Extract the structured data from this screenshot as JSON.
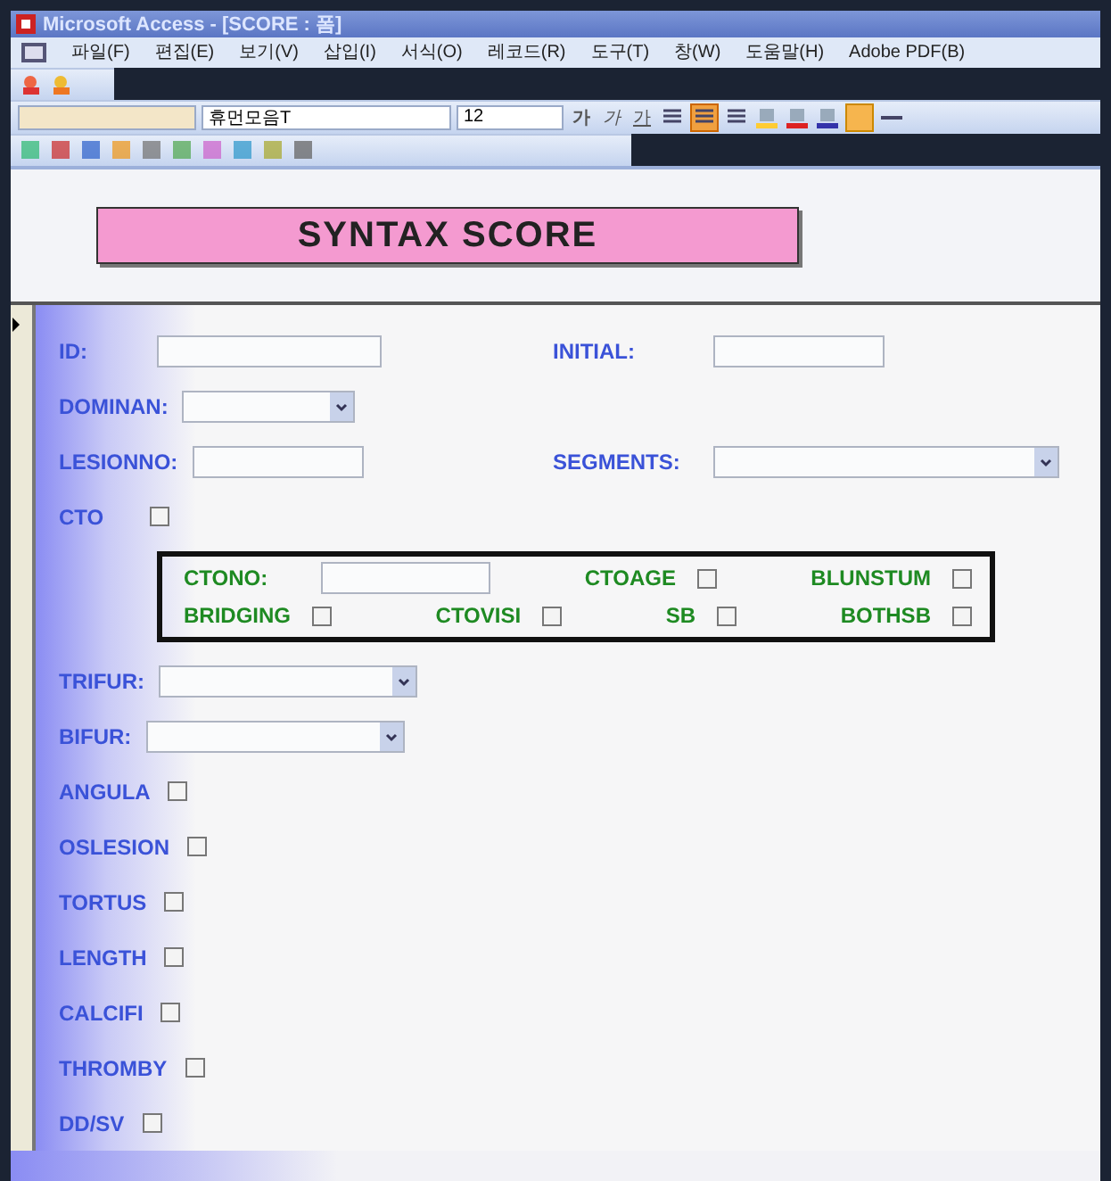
{
  "window": {
    "title": "Microsoft Access - [SCORE : 폼]"
  },
  "menu": [
    "파일(F)",
    "편집(E)",
    "보기(V)",
    "삽입(I)",
    "서식(O)",
    "레코드(R)",
    "도구(T)",
    "창(W)",
    "도움말(H)",
    "Adobe PDF(B)"
  ],
  "format_toolbar": {
    "font_name": "휴먼모음T",
    "font_size": "12",
    "bold_glyph": "가",
    "italic_glyph": "가",
    "underline_glyph": "가"
  },
  "form": {
    "title": "SYNTAX SCORE",
    "rows": [
      {
        "items": [
          {
            "kind": "text",
            "label": "ID:"
          },
          {
            "kind": "text",
            "label": "INITIAL:"
          }
        ]
      },
      {
        "items": [
          {
            "kind": "combo",
            "label": "DOMINAN:"
          }
        ]
      },
      {
        "items": [
          {
            "kind": "text",
            "label": "LESIONNO:"
          },
          {
            "kind": "combo",
            "label": "SEGMENTS:"
          }
        ]
      },
      {
        "items": [
          {
            "kind": "checkbox",
            "label": "CTO",
            "checked": false
          }
        ]
      }
    ],
    "cto_group": [
      [
        {
          "kind": "text",
          "label": "CTONO:"
        },
        {
          "kind": "checkbox",
          "label": "CTOAGE",
          "checked": false
        },
        {
          "kind": "checkbox",
          "label": "BLUNSTUM",
          "checked": false
        }
      ],
      [
        {
          "kind": "checkbox",
          "label": "BRIDGING",
          "checked": false
        },
        {
          "kind": "checkbox",
          "label": "CTOVISI",
          "checked": false
        },
        {
          "kind": "checkbox",
          "label": "SB",
          "checked": false
        },
        {
          "kind": "checkbox",
          "label": "BOTHSB",
          "checked": false
        }
      ]
    ],
    "rows_after": [
      {
        "kind": "combo",
        "label": "TRIFUR:"
      },
      {
        "kind": "combo",
        "label": "BIFUR:"
      },
      {
        "kind": "checkbox",
        "label": "ANGULA",
        "checked": false
      },
      {
        "kind": "checkbox",
        "label": "OSLESION",
        "checked": false
      },
      {
        "kind": "checkbox",
        "label": "TORTUS",
        "checked": false
      },
      {
        "kind": "checkbox",
        "label": "LENGTH",
        "checked": false
      },
      {
        "kind": "checkbox",
        "label": "CALCIFI",
        "checked": false
      },
      {
        "kind": "checkbox",
        "label": "THROMBY",
        "checked": false
      },
      {
        "kind": "checkbox",
        "label": "DD/SV",
        "checked": false
      }
    ]
  }
}
